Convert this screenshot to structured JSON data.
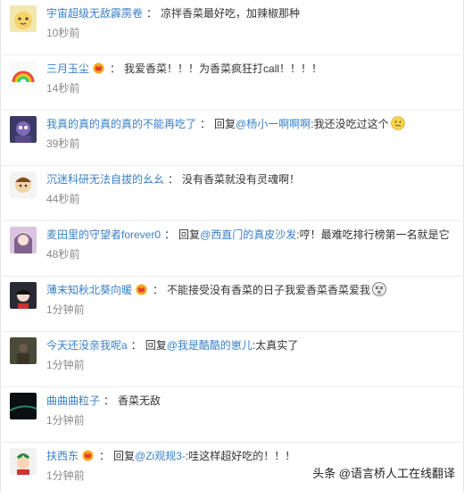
{
  "comments": [
    {
      "user": "宇宙超级无敌霹雳卷",
      "vip": false,
      "mention": "",
      "text": "凉拌香菜最好吃，加辣椒那种",
      "emoji": "",
      "time": "10秒前"
    },
    {
      "user": "三月玉尘",
      "vip": true,
      "mention": "",
      "text": "我爱香菜！！！为香菜疯狂打call！！！！",
      "emoji": "",
      "time": "14秒前"
    },
    {
      "user": "我真的真的真的真的不能再吃了",
      "vip": false,
      "mention": "杨小一啊啊啊",
      "text": "我还没吃过这个",
      "emoji": "confused-face",
      "time": "39秒前"
    },
    {
      "user": "沉迷科研无法自拔的幺幺",
      "vip": false,
      "mention": "",
      "text": "没有香菜就没有灵魂啊！",
      "emoji": "",
      "time": "44秒前"
    },
    {
      "user": "麦田里的守望者forever0",
      "vip": false,
      "mention": "西直门的真皮沙发",
      "text": "哼！最难吃排行榜第一名就是它",
      "emoji": "",
      "time": "48秒前"
    },
    {
      "user": "薄末知秋北葵向暖",
      "vip": true,
      "mention": "",
      "text": "不能接受没有香菜的日子我爱香菜香菜爱我",
      "emoji": "dizzy-face",
      "time": "1分钟前"
    },
    {
      "user": "今天还没亲我呢a",
      "vip": false,
      "mention": "我是酷酷的崽儿",
      "text": "太真实了",
      "emoji": "",
      "time": "1分钟前"
    },
    {
      "user": "曲曲曲粒子",
      "vip": false,
      "mention": "",
      "text": "香菜无敌",
      "emoji": "",
      "time": "1分钟前"
    },
    {
      "user": "扶西东",
      "vip": true,
      "mention": "Zi观规3-",
      "text": "哇这样超好吃的！！！",
      "emoji": "",
      "time": "1分钟前"
    }
  ],
  "labels": {
    "colon": "：",
    "reply_prefix": "回复@"
  },
  "watermark": "头条 @语言桥人工在线翻译",
  "colors": {
    "username": "#3a7fc6",
    "text": "#333333",
    "time": "#888888",
    "vip": "#f5a623"
  }
}
